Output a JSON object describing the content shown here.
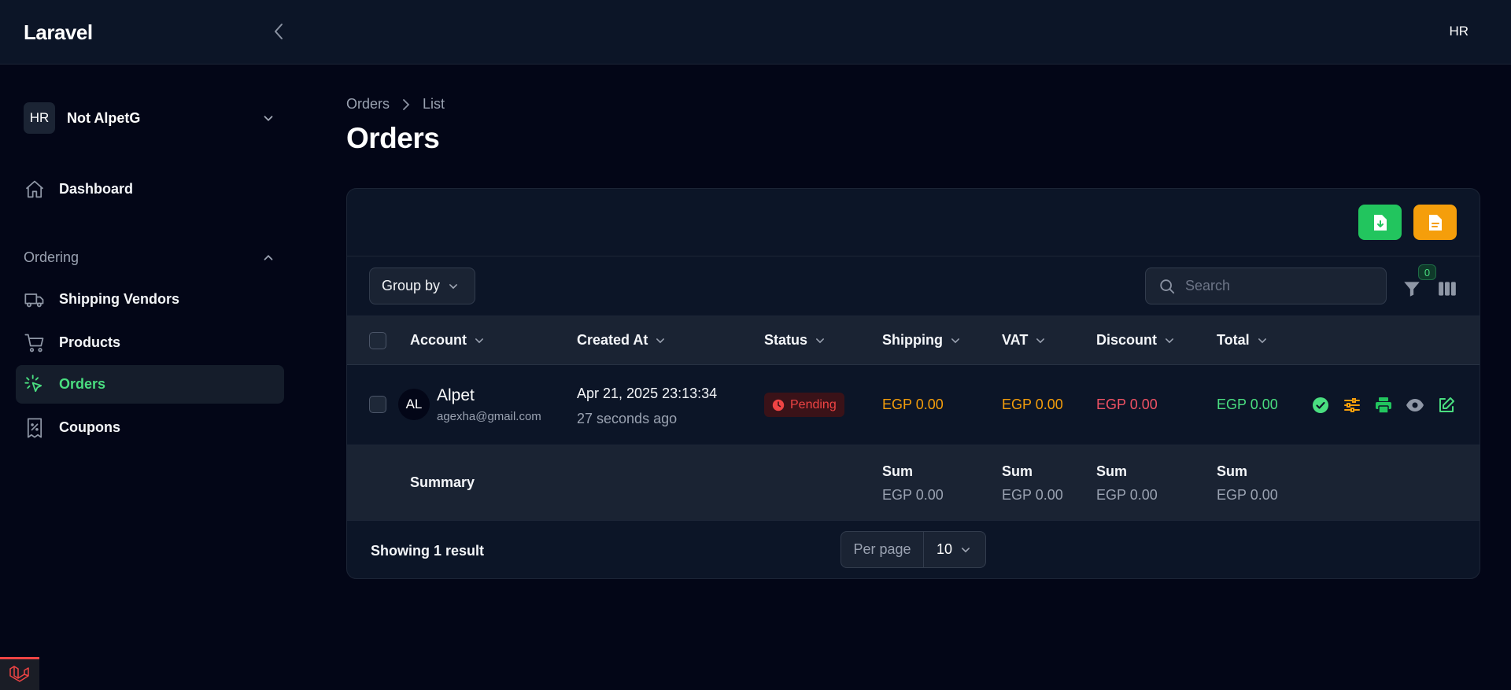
{
  "topbar": {
    "brand": "Laravel",
    "user_initials": "HR"
  },
  "sidebar": {
    "tenant": {
      "initials": "HR",
      "name": "Not AlpetG"
    },
    "dashboard": {
      "label": "Dashboard",
      "icon": "home-icon"
    },
    "group": {
      "label": "Ordering"
    },
    "items": [
      {
        "label": "Shipping Vendors",
        "icon": "truck-icon"
      },
      {
        "label": "Products",
        "icon": "cart-icon"
      },
      {
        "label": "Orders",
        "icon": "cursor-click-icon",
        "active": true
      },
      {
        "label": "Coupons",
        "icon": "receipt-percent-icon"
      }
    ]
  },
  "breadcrumb": {
    "items": [
      "Orders",
      "List"
    ]
  },
  "page": {
    "title": "Orders"
  },
  "toolbar": {
    "group_by_label": "Group by",
    "search_placeholder": "Search",
    "filter_count": "0"
  },
  "table": {
    "columns": [
      "Account",
      "Created At",
      "Status",
      "Shipping",
      "VAT",
      "Discount",
      "Total"
    ],
    "rows": [
      {
        "avatar": "AL",
        "name": "Alpet",
        "email": "agexha@gmail.com",
        "created_at": "Apr 21, 2025 23:13:34",
        "created_rel": "27 seconds ago",
        "status": "Pending",
        "shipping": "EGP 0.00",
        "vat": "EGP 0.00",
        "discount": "EGP 0.00",
        "total": "EGP 0.00"
      }
    ],
    "summary": {
      "title": "Summary",
      "label": "Sum",
      "shipping": "EGP 0.00",
      "vat": "EGP 0.00",
      "discount": "EGP 0.00",
      "total": "EGP 0.00"
    }
  },
  "footer": {
    "showing": "Showing 1 result",
    "per_page_label": "Per page",
    "per_page_value": "10"
  },
  "colors": {
    "accent_green": "#4ade80",
    "export_button": "#22c55e",
    "pdf_button": "#f59e0b",
    "pending": "#ef4444",
    "background": "#030617"
  }
}
